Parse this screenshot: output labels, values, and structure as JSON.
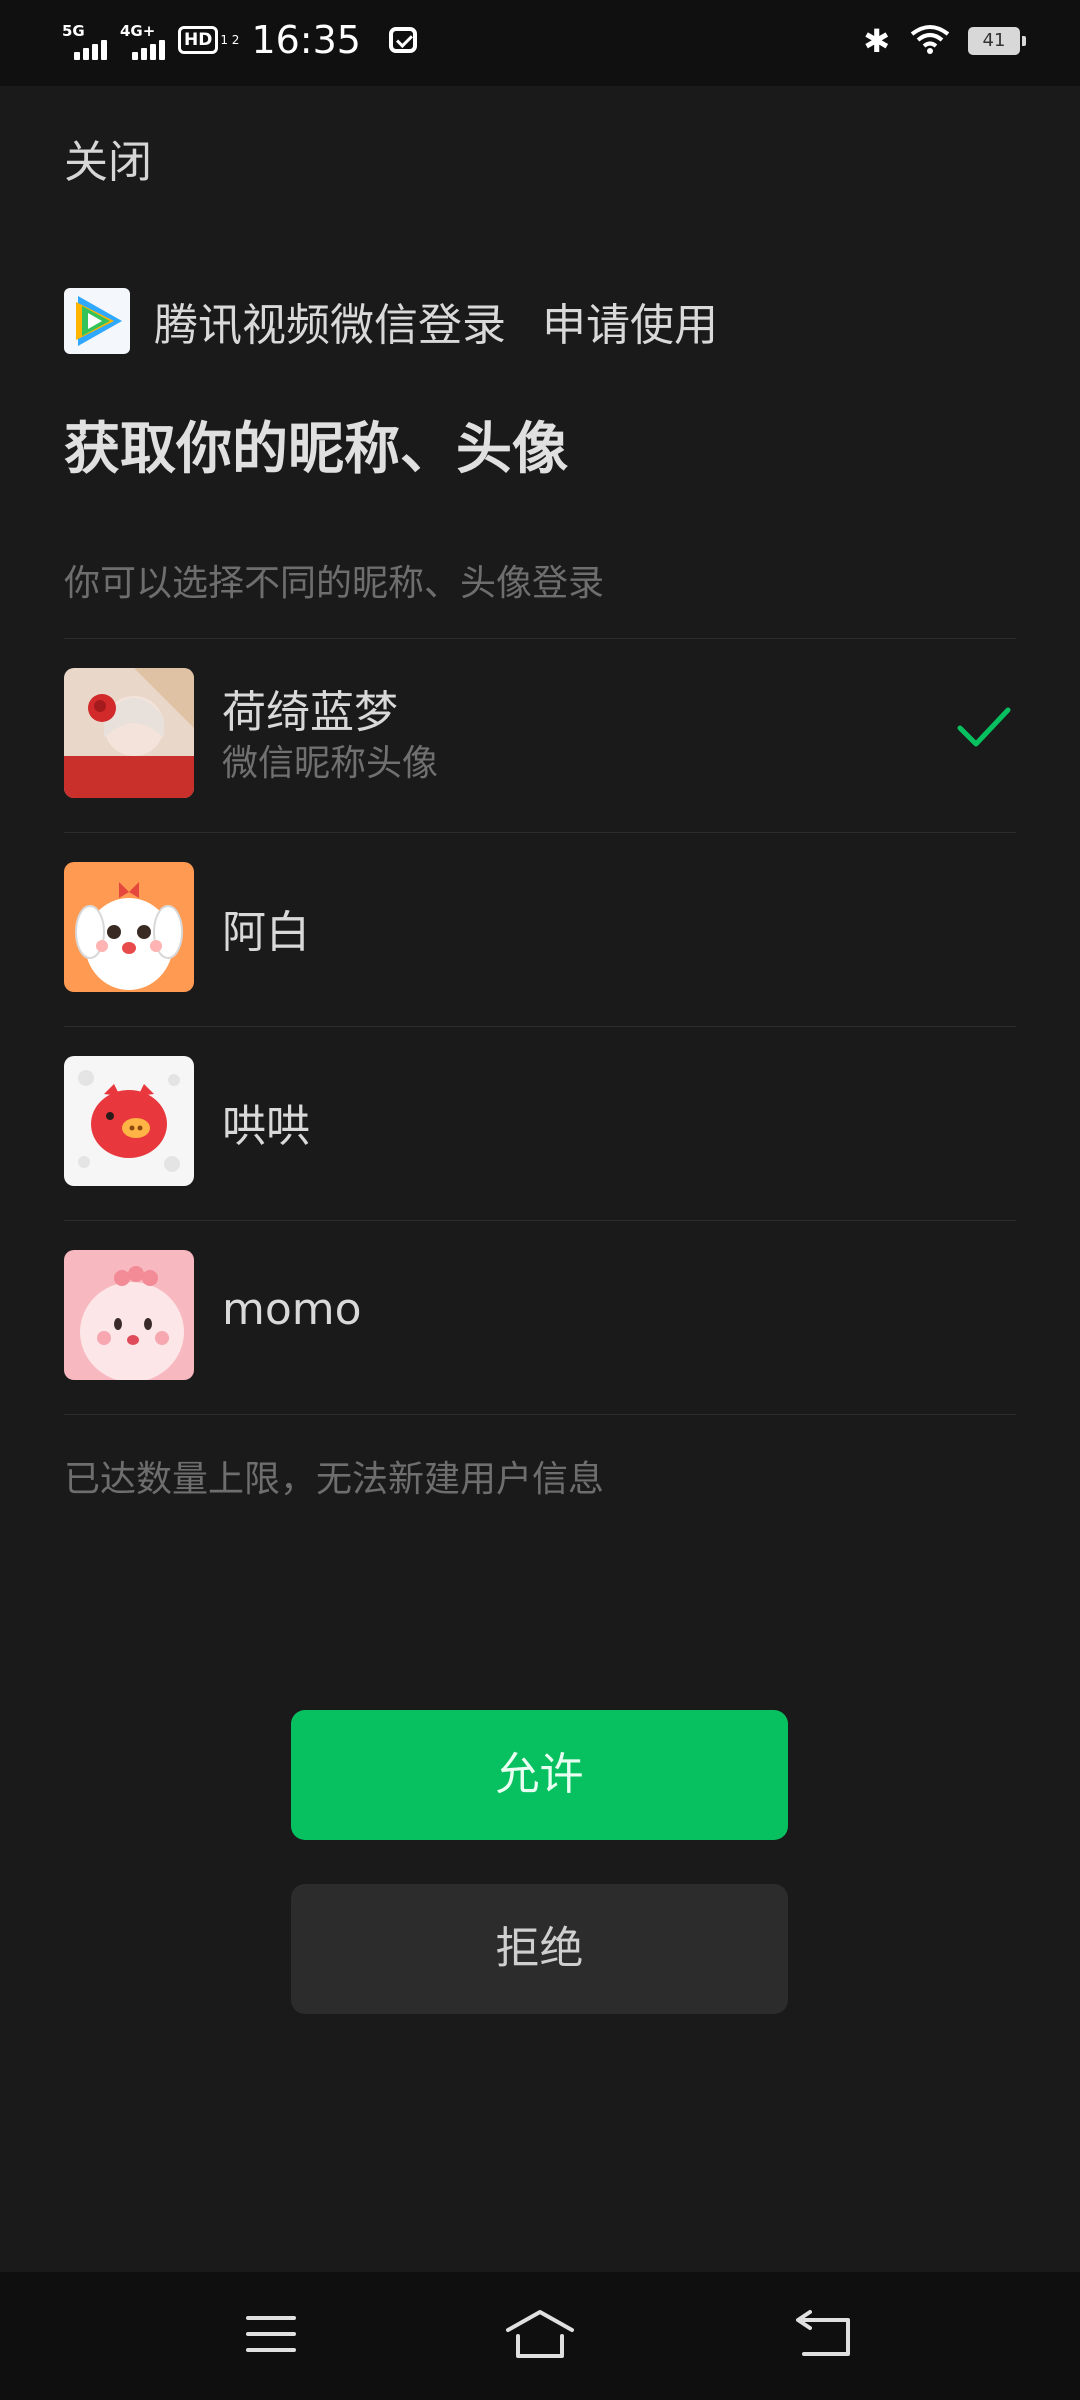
{
  "status_bar": {
    "sim1_label": "5G",
    "sim2_label": "4G+",
    "hd_label": "HD",
    "hd_sub": "1 2",
    "time": "16:35",
    "battery": "41",
    "icons": [
      "signal-icon",
      "hd-icon",
      "message-icon",
      "bluetooth-icon",
      "wifi-icon",
      "battery-icon"
    ]
  },
  "header": {
    "close_label": "关闭"
  },
  "app": {
    "name": "腾讯视频微信登录",
    "request_label": "申请使用"
  },
  "request": {
    "title": "获取你的昵称、头像",
    "subtitle": "你可以选择不同的昵称、头像登录"
  },
  "accounts": [
    {
      "name": "荷绮蓝梦",
      "desc": "微信昵称头像",
      "selected": true
    },
    {
      "name": "阿白",
      "desc": "",
      "selected": false
    },
    {
      "name": "哄哄",
      "desc": "",
      "selected": false
    },
    {
      "name": "momo",
      "desc": "",
      "selected": false
    }
  ],
  "limit_note": "已达数量上限，无法新建用户信息",
  "buttons": {
    "allow": "允许",
    "deny": "拒绝"
  },
  "colors": {
    "accent": "#07c160",
    "background": "#1a1a1a",
    "secondary_button": "#2c2c2c"
  },
  "nav_bar": {
    "icons": [
      "menu-icon",
      "home-icon",
      "back-icon"
    ]
  }
}
